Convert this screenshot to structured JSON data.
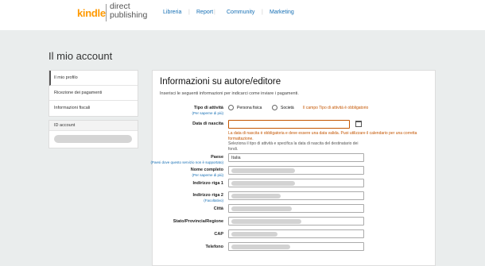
{
  "header": {
    "logo_kindle": "kindle",
    "logo_direct": "direct",
    "logo_publishing": "publishing",
    "nav": [
      "Libreria",
      "Report",
      "Community",
      "Marketing"
    ]
  },
  "page_title": "Il mio account",
  "sidebar": {
    "items": [
      {
        "label": "Il mio profilo"
      },
      {
        "label": "Ricezione dei pagamenti"
      },
      {
        "label": "Informazioni fiscali"
      }
    ],
    "account_header": "ID account"
  },
  "form": {
    "title": "Informazioni su autore/editore",
    "subtitle": "Inserisci le seguenti informazioni per indicarci come inviare i pagamenti.",
    "tipo_attivita": {
      "label": "Tipo di attività",
      "help": "(Per saperne di più)",
      "options": [
        "Persona fisica",
        "Società"
      ],
      "error": "Il campo Tipo di attività è obbligatorio"
    },
    "data_nascita": {
      "label": "Data di nascita",
      "value": "",
      "error": "La data di nascita è obbligatoria e deve essere una data valida. Puoi utilizzare il calendario per una corretta formattazione.",
      "note": "Seleziona il tipo di attività e specifica la data di nascita del destinatario dei fondi."
    },
    "paese": {
      "label": "Paese",
      "help": "(Paesi dove questo servizio non è supportato)",
      "value": "Italia"
    },
    "nome_completo": {
      "label": "Nome completo",
      "help": "(Per saperne di più)"
    },
    "indirizzo1": {
      "label": "Indirizzo riga 1"
    },
    "indirizzo2": {
      "label": "Indirizzo riga 2",
      "help": "(Facoltativo)"
    },
    "citta": {
      "label": "Città"
    },
    "stato": {
      "label": "Stato/Provincia/Regione"
    },
    "cap": {
      "label": "CAP"
    },
    "telefono": {
      "label": "Telefono"
    }
  },
  "colors": {
    "accent": "#ff9900",
    "link": "#146eb4",
    "error": "#c45500",
    "background": "#eaeded"
  }
}
